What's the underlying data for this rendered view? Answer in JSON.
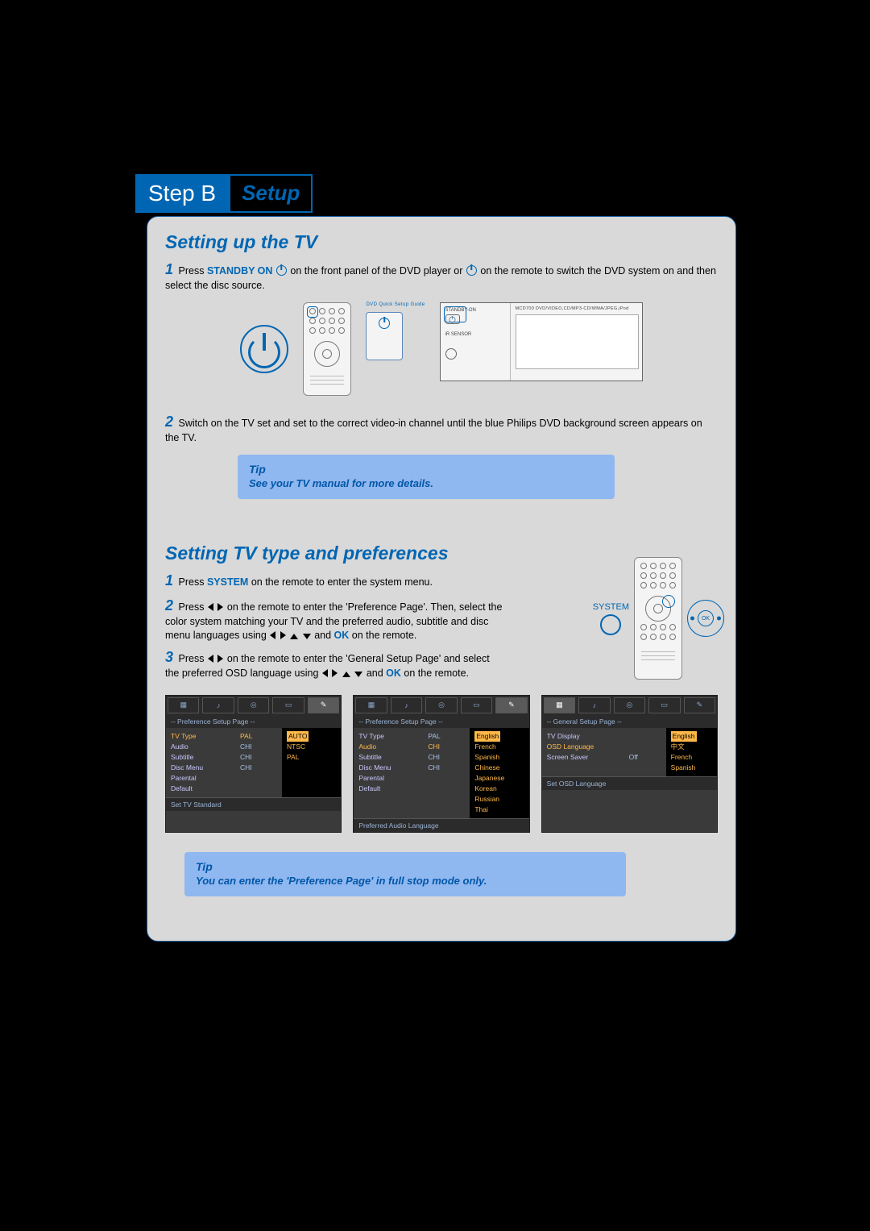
{
  "step_badge": {
    "left": "Step B",
    "right": "Setup"
  },
  "section1": {
    "title": "Setting up the TV",
    "s1a": "Press ",
    "s1_standby": "STANDBY ON",
    "s1b": " on the front panel of the DVD player or ",
    "s1c": " on the remote to switch the DVD system on and then select the disc source.",
    "s2": "Switch on the TV set and set to the correct video-in channel until the blue Philips DVD background screen appears on the TV.",
    "illus": {
      "remote_top_label": "DVD Quick Setup Guide",
      "dvd_standby_label": "STANDBY-ON",
      "dvd_ir_label": "iR  SENSOR",
      "dvd_title": "MCD700 DVD/VIDEO,CD/MP3-CD/WMA/JPEG,iPod"
    },
    "tip": {
      "title": "Tip",
      "body": "See your TV manual for more details."
    }
  },
  "section2": {
    "title": "Setting TV type and preferences",
    "s1a": "Press ",
    "s1_system": "SYSTEM",
    "s1b": " on the remote to enter the system menu.",
    "s2a": "Press ",
    "s2b": " on the remote to enter the 'Preference Page'. Then, select the color system matching your TV and the preferred audio, subtitle and disc menu languages using ",
    "s2c": " and ",
    "s2_ok": "OK",
    "s2d": " on the remote.",
    "s3a": "Press ",
    "s3b": " on the remote to enter the 'General Setup Page' and select the preferred OSD language using ",
    "s3c": " and ",
    "s3_ok": "OK",
    "s3d": " on the remote.",
    "system_label": "SYSTEM",
    "tip": {
      "title": "Tip",
      "body": "You can enter the 'Preference Page' in full stop mode only."
    }
  },
  "osd1": {
    "header": "-- Preference Setup Page --",
    "labels": [
      "TV Type",
      "Audio",
      "Subtitle",
      "Disc Menu",
      "Parental",
      "Default"
    ],
    "vals": [
      "PAL",
      "CHI",
      "CHI",
      "CHI",
      "",
      ""
    ],
    "opts": [
      "AUTO",
      "NTSC",
      "PAL"
    ],
    "footer": "Set TV Standard",
    "selected_label": "TV Type",
    "selected_opt": "AUTO"
  },
  "osd2": {
    "header": "-- Preference Setup Page --",
    "labels": [
      "TV Type",
      "Audio",
      "Subtitle",
      "Disc Menu",
      "Parental",
      "Default"
    ],
    "vals": [
      "PAL",
      "CHI",
      "CHI",
      "CHI",
      "",
      ""
    ],
    "opts": [
      "English",
      "French",
      "Spanish",
      "Chinese",
      "Japanese",
      "Korean",
      "Russian",
      "Thai"
    ],
    "footer": "Preferred Audio Language",
    "selected_label": "Audio",
    "selected_opt": "English"
  },
  "osd3": {
    "header": "-- General Setup Page --",
    "labels": [
      "TV Display",
      "OSD Language",
      "Screen Saver"
    ],
    "vals": [
      "",
      "",
      "Off"
    ],
    "opts": [
      "English",
      "中文",
      "French",
      "Spanish"
    ],
    "footer": "Set OSD Language",
    "selected_label": "OSD Language",
    "selected_opt": "English"
  }
}
